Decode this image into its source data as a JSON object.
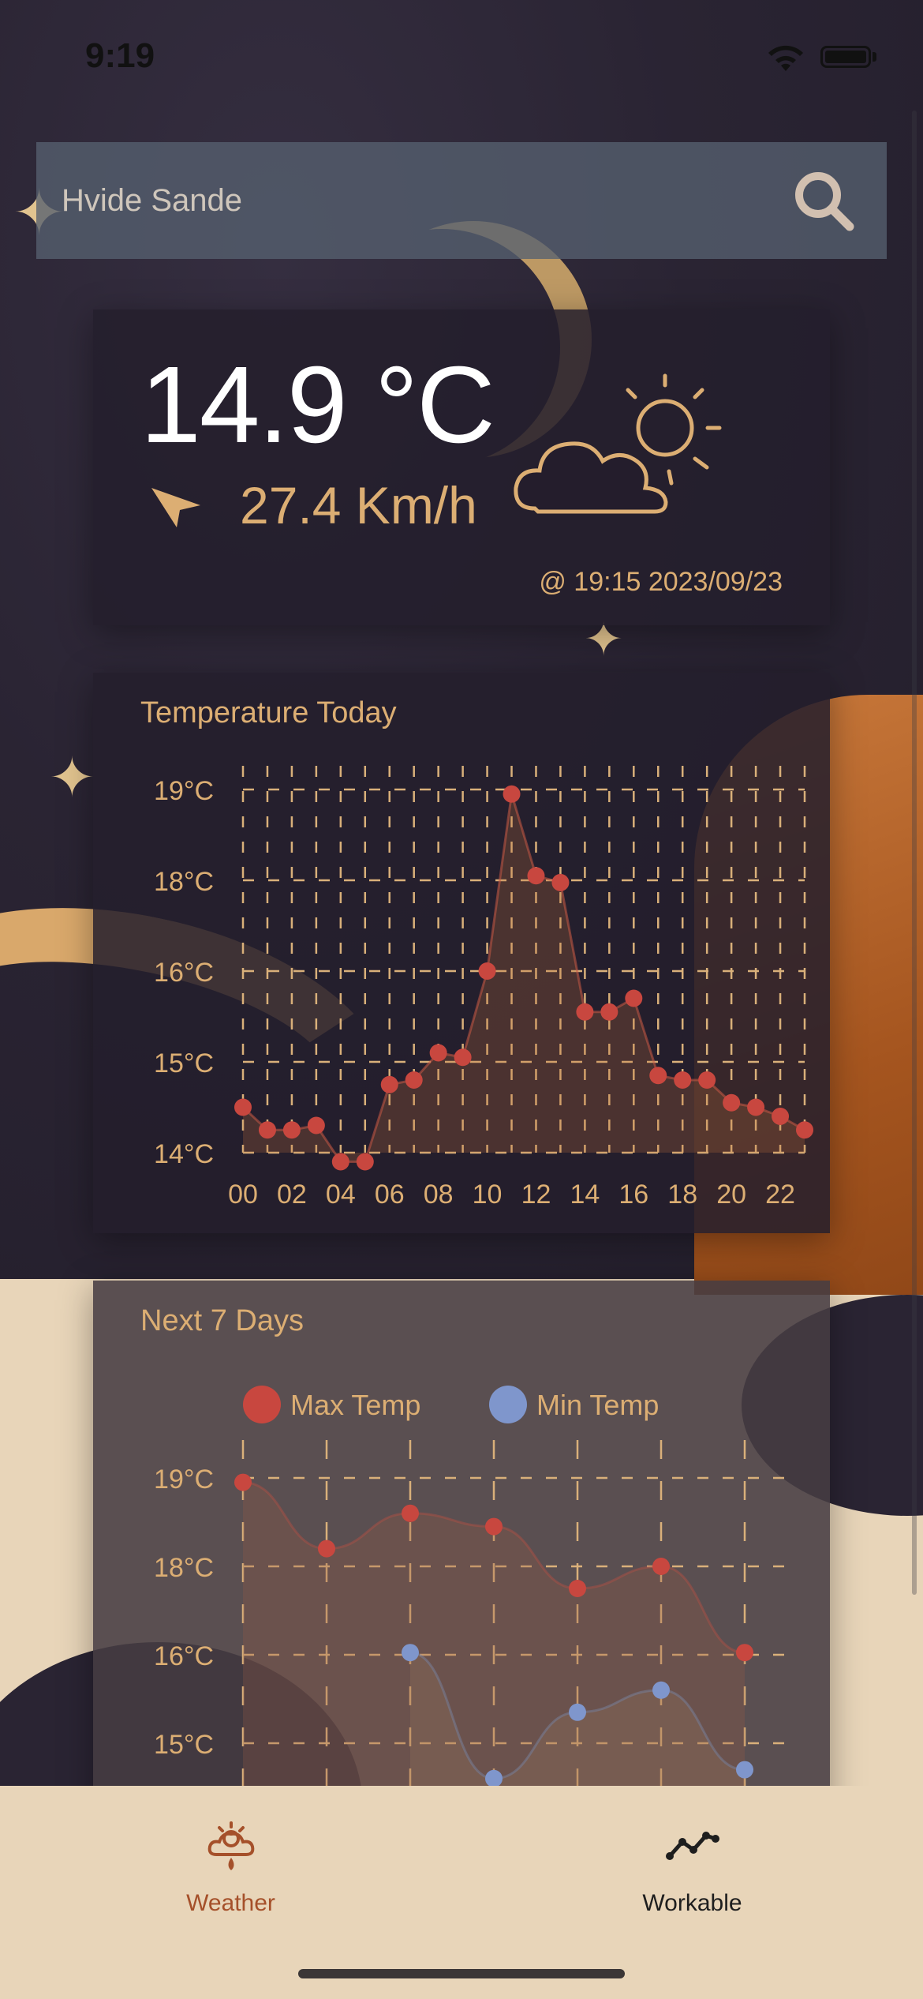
{
  "status_bar": {
    "time": "9:19",
    "wifi_icon": "wifi-icon",
    "battery_icon": "battery-icon"
  },
  "search": {
    "placeholder": "Hvide Sande",
    "value": "",
    "icon": "search-icon"
  },
  "current": {
    "temperature": "14.9 °C",
    "wind_speed": "27.4 Km/h",
    "wind_icon": "wind-direction-arrow-icon",
    "condition_icon": "partly-cloudy-icon",
    "updated": "@ 19:15 2023/09/23"
  },
  "temperature_today": {
    "title": "Temperature Today",
    "chart_data": {
      "type": "line",
      "x": [
        "00",
        "01",
        "02",
        "03",
        "04",
        "05",
        "06",
        "07",
        "08",
        "09",
        "10",
        "11",
        "12",
        "13",
        "14",
        "15",
        "16",
        "17",
        "18",
        "19",
        "20",
        "21",
        "22",
        "23"
      ],
      "xticks": [
        "00",
        "02",
        "04",
        "06",
        "08",
        "10",
        "12",
        "14",
        "16",
        "18",
        "20",
        "22"
      ],
      "yticks": [
        "14°C",
        "15°C",
        "16°C",
        "18°C",
        "19°C"
      ],
      "series": [
        {
          "values": [
            14.5,
            14.25,
            14.25,
            14.3,
            13.9,
            13.9,
            14.75,
            14.8,
            15.1,
            15.05,
            16.0,
            18.95,
            18.05,
            17.95,
            15.55,
            15.55,
            15.7,
            14.85,
            14.8,
            14.8,
            14.55,
            14.5,
            14.4,
            14.25
          ],
          "color": "#c8473f"
        }
      ],
      "grid": true
    }
  },
  "next_7_days": {
    "title": "Next 7 Days",
    "chart_data": {
      "type": "line",
      "yticks": [
        "15°C",
        "16°C",
        "18°C",
        "19°C"
      ],
      "series": [
        {
          "name": "Max Temp",
          "color": "#c8473f",
          "values": [
            18.95,
            18.2,
            18.6,
            18.45,
            17.5,
            18.0,
            16.05
          ]
        },
        {
          "name": "Min Temp",
          "color": "#7f96cc",
          "values": [
            null,
            null,
            16.05,
            14.6,
            15.35,
            15.6,
            14.7
          ]
        }
      ],
      "legend": "top",
      "grid": true
    }
  },
  "tabs": [
    {
      "label": "Weather",
      "icon": "weather-icon",
      "active": true,
      "color": "#a5502a"
    },
    {
      "label": "Workable",
      "icon": "chart-line-icon",
      "active": false,
      "color": "#1e1e1e"
    }
  ]
}
